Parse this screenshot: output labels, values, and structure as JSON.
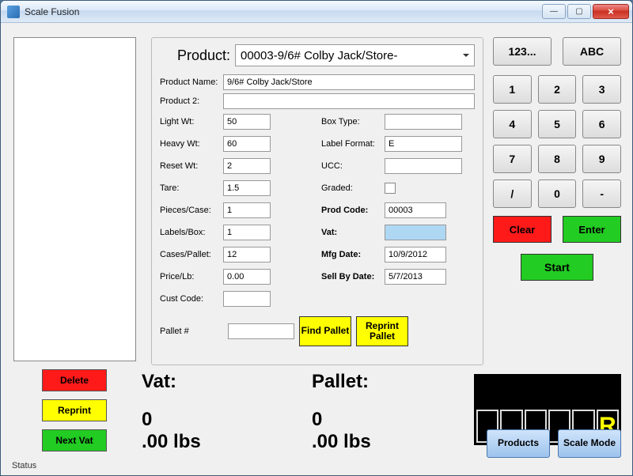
{
  "window": {
    "title": "Scale Fusion"
  },
  "left": {
    "delete": "Delete",
    "reprint": "Reprint",
    "next_vat": "Next Vat"
  },
  "form": {
    "product_label": "Product:",
    "product_value": "00003-9/6# Colby Jack/Store-",
    "product_name_label": "Product Name:",
    "product_name": "9/6# Colby Jack/Store",
    "product2_label": "Product 2:",
    "product2": "",
    "light_wt_label": "Light Wt:",
    "light_wt": "50",
    "heavy_wt_label": "Heavy Wt:",
    "heavy_wt": "60",
    "reset_wt_label": "Reset Wt:",
    "reset_wt": "2",
    "tare_label": "Tare:",
    "tare": "1.5",
    "pieces_case_label": "Pieces/Case:",
    "pieces_case": "1",
    "labels_box_label": "Labels/Box:",
    "labels_box": "1",
    "cases_pallet_label": "Cases/Pallet:",
    "cases_pallet": "12",
    "price_lb_label": "Price/Lb:",
    "price_lb": "0.00",
    "cust_code_label": "Cust Code:",
    "cust_code": "",
    "box_type_label": "Box Type:",
    "box_type": "",
    "label_format_label": "Label Format:",
    "label_format": "E",
    "ucc_label": "UCC:",
    "ucc": "",
    "graded_label": "Graded:",
    "prod_code_label": "Prod Code:",
    "prod_code": "00003",
    "vat_label": "Vat:",
    "vat": "",
    "mfg_date_label": "Mfg Date:",
    "mfg_date": "10/9/2012",
    "sell_by_label": "Sell By Date:",
    "sell_by": "5/7/2013",
    "pallet_num_label": "Pallet #",
    "pallet_num": "",
    "find_pallet": "Find Pallet",
    "reprint_pallet": "Reprint Pallet"
  },
  "numpad": {
    "mode_num": "123...",
    "mode_abc": "ABC",
    "k1": "1",
    "k2": "2",
    "k3": "3",
    "k4": "4",
    "k5": "5",
    "k6": "6",
    "k7": "7",
    "k8": "8",
    "k9": "9",
    "kslash": "/",
    "k0": "0",
    "kdash": "-",
    "clear": "Clear",
    "enter": "Enter",
    "start": "Start"
  },
  "readouts": {
    "vat_label": "Vat:",
    "pallet_label": "Pallet:",
    "vat_count": "0",
    "vat_wt": ".00 lbs",
    "pallet_count": "0",
    "pallet_wt": ".00 lbs"
  },
  "scale": {
    "indicator": "R"
  },
  "bottom": {
    "products": "Products",
    "scale_mode": "Scale Mode"
  },
  "status": "Status"
}
